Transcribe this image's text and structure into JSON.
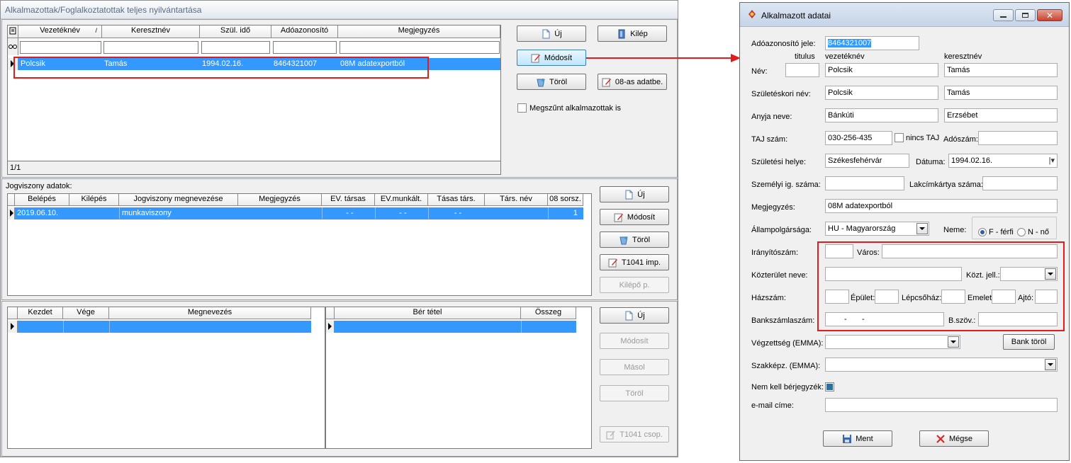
{
  "main": {
    "title": "Alkalmazottak/Foglalkoztatottak teljes nyilvántartása",
    "employees": {
      "columns": [
        "Vezetéknév",
        "Keresztnév",
        "Szül. idő",
        "Adóazonosító",
        "Megjegyzés"
      ],
      "sort_mark": "/",
      "row": [
        "Polcsik",
        "Tamás",
        "1994.02.16.",
        "8464321007",
        "08M adatexportból"
      ],
      "status": "1/1"
    },
    "buttons": {
      "new": "Új",
      "exit": "Kilép",
      "modify": "Módosít",
      "delete": "Töröl",
      "import08": "08-as adatbe."
    },
    "include_terminated_label": "Megszűnt alkalmazottak is",
    "legal": {
      "label": "Jogviszony adatok:",
      "columns": [
        "Belépés",
        "Kilépés",
        "Jogviszony megnevezése",
        "Megjegyzés",
        "EV. társas",
        "EV.munkált.",
        "Tásas társ.",
        "Társ. név",
        "08 sorsz."
      ],
      "row": [
        "2019.06.10.",
        "",
        "munkaviszony",
        "",
        "- -",
        "- -",
        "- -",
        "",
        "1"
      ],
      "buttons": {
        "new": "Új",
        "modify": "Módosít",
        "delete": "Töröl",
        "import": "T1041 imp.",
        "exit_p": "Kilépő p."
      }
    },
    "lower": {
      "columns_left": [
        "Kezdet",
        "Vége",
        "Megnevezés"
      ],
      "columns_right": [
        "Bér tétel",
        "Összeg"
      ],
      "buttons": {
        "new": "Új",
        "modify": "Módosít",
        "copy": "Másol",
        "delete": "Töröl",
        "group": "T1041 csop."
      }
    }
  },
  "dialog": {
    "title": "Alkalmazott adatai",
    "tax_id_label": "Adóazonosító jele:",
    "tax_id": "8464321007",
    "col_title": "titulus",
    "col_surname": "vezetéknév",
    "col_firstname": "keresztnév",
    "name_label": "Név:",
    "title_value": "",
    "surname": "Polcsik",
    "firstname": "Tamás",
    "birth_name_label": "Születéskori név:",
    "birth_surname": "Polcsik",
    "birth_firstname": "Tamás",
    "mother_label": "Anyja neve:",
    "mother_surname": "Bánkúti",
    "mother_firstname": "Erzsébet",
    "taj_label": "TAJ szám:",
    "taj": "030-256-435",
    "no_taj_label": "nincs TAJ",
    "tax_number_label": "Adószám:",
    "tax_number": "",
    "birthplace_label": "Születési helye:",
    "birthplace": "Székesfehérvár",
    "date_label": "Dátuma:",
    "birth_date": "1994.02.16.",
    "id_card_label": "Személyi ig. száma:",
    "id_card": "",
    "address_card_label": "Lakcímkártya száma:",
    "address_card": "",
    "note_label": "Megjegyzés:",
    "note": "08M adatexportból",
    "citizenship_label": "Állampolgársága:",
    "citizenship": "HU - Magyarország",
    "gender_label": "Neme:",
    "gender_male": "F - férfi",
    "gender_female": "N - nő",
    "zip_label": "Irányítószám:",
    "zip": "",
    "city_label": "Város:",
    "city": "",
    "street_label": "Közterület neve:",
    "street": "",
    "street_type_label": "Közt. jell.:",
    "street_type": "",
    "house_no_label": "Házszám:",
    "building_label": "Épület:",
    "staircase_label": "Lépcsőház:",
    "floor_label": "Emelet:",
    "door_label": "Ajtó:",
    "bank_account_label": "Bankszámlaszám:",
    "bank_account": "-       -",
    "bank_text_label": "B.szöv.:",
    "education_label": "Végzettség (EMMA):",
    "qualification_label": "Szakképz. (EMMA):",
    "bank_delete_button": "Bank töröl",
    "no_payslip_label": "Nem kell bérjegyzék:",
    "email_label": "e-mail címe:",
    "save_button": "Ment",
    "cancel_button": "Mégse"
  },
  "colors": {
    "selection": "#3399ff",
    "highlight_box": "#e41b1b",
    "arrow": "#e41b1b"
  }
}
